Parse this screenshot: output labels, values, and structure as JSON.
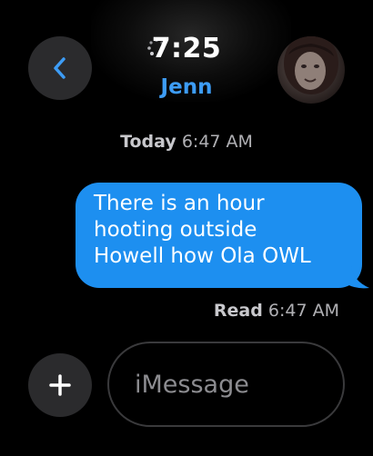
{
  "header": {
    "time": "7:25",
    "contact_name": "Jenn",
    "back_icon": "chevron-left-icon",
    "avatar": "contact-photo"
  },
  "conversation": {
    "timestamp_day": "Today",
    "timestamp_time": "6:47 AM",
    "messages": [
      {
        "direction": "outgoing",
        "lines": [
          "There is an hour",
          "hooting outside",
          "Howell how Ola OWL"
        ]
      }
    ],
    "read_receipt_label": "Read",
    "read_receipt_time": "6:47 AM"
  },
  "composer": {
    "plus_icon": "plus-icon",
    "placeholder": "iMessage"
  },
  "colors": {
    "background": "#000000",
    "accent": "#3d9cf5",
    "bubble": "#1d8ff0",
    "control": "#2b2b2d"
  }
}
